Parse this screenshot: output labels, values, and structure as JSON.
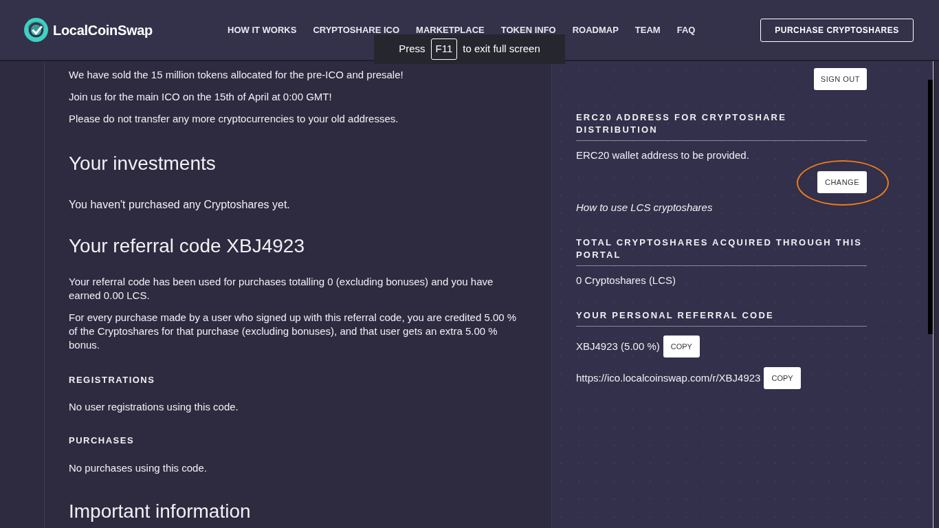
{
  "header": {
    "logo_text": "LocalCoinSwap",
    "nav": [
      "HOW IT WORKS",
      "CRYPTOSHARE ICO",
      "MARKETPLACE",
      "TOKEN INFO",
      "ROADMAP",
      "TEAM",
      "FAQ"
    ],
    "cta_button": "PURCHASE CRYPTOSHARES"
  },
  "fullscreen_toast": {
    "before": "Press",
    "key": "F11",
    "after": "to exit full screen"
  },
  "main": {
    "notices": [
      "We have sold the 15 million tokens allocated for the pre-ICO and presale!",
      "Join us for the main ICO on the 15th of April at 0:00 GMT!",
      "Please do not transfer any more cryptocurrencies to your old addresses."
    ],
    "investments": {
      "heading": "Your investments",
      "text": "You haven't purchased any Cryptoshares yet."
    },
    "referral": {
      "heading": "Your referral code XBJ4923",
      "paragraphs": [
        "Your referral code has been used for purchases totalling 0 (excluding bonuses) and you have earned 0.00 LCS.",
        "For every purchase made by a user who signed up with this referral code, you are credited 5.00 % of the Cryptoshares for that purchase (excluding bonuses), and that user gets an extra 5.00 % bonus."
      ],
      "registrations": {
        "heading": "REGISTRATIONS",
        "text": "No user registrations using this code."
      },
      "purchases": {
        "heading": "PURCHASES",
        "text": "No purchases using this code."
      }
    },
    "important_heading": "Important information"
  },
  "sidebar": {
    "sign_out": "SIGN OUT",
    "erc20": {
      "heading": "ERC20 ADDRESS FOR CRYPTOSHARE DISTRIBUTION",
      "text": "ERC20 wallet address to be provided.",
      "button": "CHANGE",
      "highlighted": true,
      "link": "How to use LCS cryptoshares"
    },
    "total": {
      "heading": "TOTAL CRYPTOSHARES ACQUIRED THROUGH THIS PORTAL",
      "text": "0 Cryptoshares (LCS)"
    },
    "personal_code": {
      "heading": "YOUR PERSONAL REFERRAL CODE",
      "rows": [
        {
          "text": "XBJ4923 (5.00 %)",
          "button": "COPY"
        },
        {
          "text": "https://ico.localcoinswap.com/r/XBJ4923",
          "button": "COPY"
        }
      ]
    }
  }
}
